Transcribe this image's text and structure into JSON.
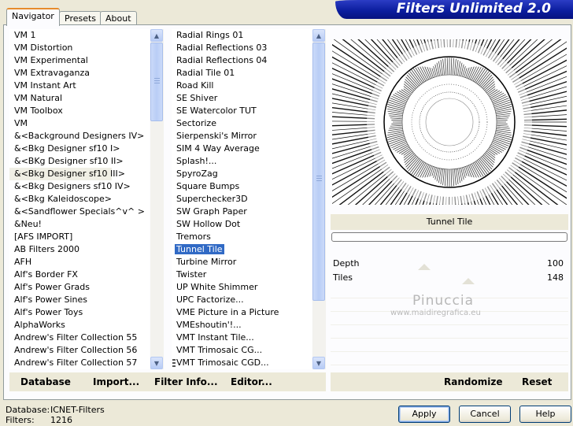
{
  "banner": {
    "title": "Filters Unlimited 2.0"
  },
  "tabs": [
    {
      "label": "Navigator",
      "active": true
    },
    {
      "label": "Presets",
      "active": false
    },
    {
      "label": "About",
      "active": false
    }
  ],
  "categories": [
    "VM 1",
    "VM Distortion",
    "VM Experimental",
    "VM Extravaganza",
    "VM Instant Art",
    "VM Natural",
    "VM Toolbox",
    "VM",
    "&<Background Designers IV>",
    "&<Bkg Designer sf10 I>",
    "&<BKg Designer sf10 II>",
    "&<Bkg Designer sf10 III>",
    "&<Bkg Designers sf10 IV>",
    "&<Bkg Kaleidoscope>",
    "&<Sandflower Specials^v^ >",
    "&Neu!",
    "[AFS IMPORT]",
    "AB Filters 2000",
    "AFH",
    "Alf's Border FX",
    "Alf's Power Grads",
    "Alf's Power Sines",
    "Alf's Power Toys",
    "AlphaWorks",
    "Andrew's Filter Collection 55",
    "Andrew's Filter Collection 56",
    "Andrew's Filter Collection 57"
  ],
  "filters": [
    "Radial  Rings 01",
    "Radial Reflections 03",
    "Radial Reflections 04",
    "Radial Tile 01",
    "Road Kill",
    "SE Shiver",
    "SE Watercolor TUT",
    "Sectorize",
    "Sierpenski's Mirror",
    "SIM 4 Way Average",
    "Splash!...",
    "SpyroZag",
    "Square Bumps",
    "Superchecker3D",
    "SW Graph Paper",
    "SW Hollow Dot",
    "Tremors",
    "Tunnel Tile",
    "Turbine Mirror",
    "Twister",
    "UP White Shimmer",
    "UPC Factorize...",
    "VME Picture in a Picture",
    "VMEshoutin'!...",
    "VMT Instant Tile...",
    "VMT Trimosaic CG...",
    "VMT Trimosaic CGD..."
  ],
  "selected_category_index": 11,
  "selected_filter_index": 17,
  "filter_name": "Tunnel Tile",
  "params": [
    {
      "label": "Depth",
      "value": "100"
    },
    {
      "label": "Tiles",
      "value": "148"
    }
  ],
  "watermark": {
    "name": "Pinuccia",
    "url": "www.maidiregrafica.eu"
  },
  "toolbar": {
    "database": "Database",
    "import": "Import...",
    "filter_info": "Filter Info...",
    "editor": "Editor...",
    "randomize": "Randomize",
    "reset": "Reset"
  },
  "status": {
    "database_label": "Database:",
    "database_value": "ICNET-Filters",
    "filters_label": "Filters:",
    "filters_value": "1216"
  },
  "buttons": {
    "apply": "Apply",
    "cancel": "Cancel",
    "help": "Help"
  },
  "colors": {
    "banner": "#0a1c9c",
    "selection": "#316ac5",
    "dialog_bg": "#ece9d8"
  },
  "icons": {
    "scroll_up": "scroll-up-arrow-icon",
    "scroll_down": "scroll-down-arrow-icon",
    "list_drag": "drag-grip-icon"
  }
}
